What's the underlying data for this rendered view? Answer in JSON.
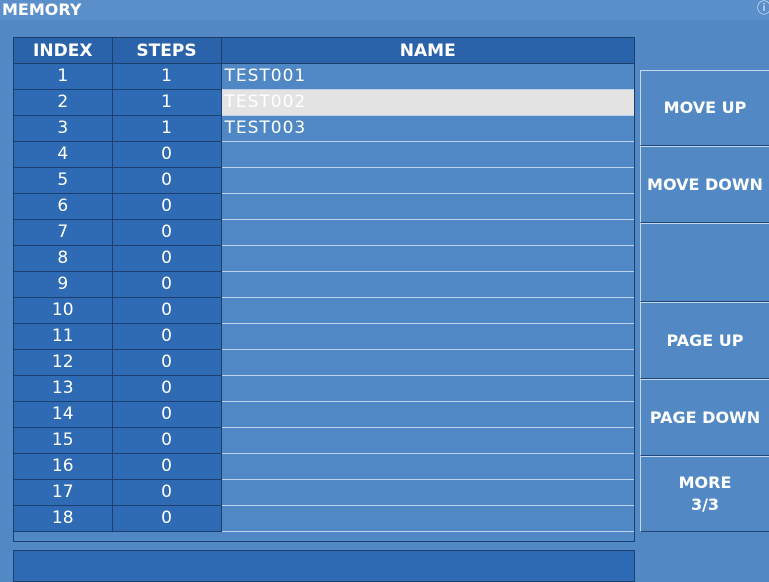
{
  "window": {
    "title": "MEMORY",
    "corner_icon": "info-icon",
    "corner_glyph": "ⓘ"
  },
  "table": {
    "headers": {
      "index": "INDEX",
      "steps": "STEPS",
      "name": "NAME"
    },
    "rows": [
      {
        "index": "1",
        "steps": "1",
        "name": "TEST001",
        "selected": false
      },
      {
        "index": "2",
        "steps": "1",
        "name": "TEST002",
        "selected": true
      },
      {
        "index": "3",
        "steps": "1",
        "name": "TEST003",
        "selected": false
      },
      {
        "index": "4",
        "steps": "0",
        "name": "",
        "selected": false
      },
      {
        "index": "5",
        "steps": "0",
        "name": "",
        "selected": false
      },
      {
        "index": "6",
        "steps": "0",
        "name": "",
        "selected": false
      },
      {
        "index": "7",
        "steps": "0",
        "name": "",
        "selected": false
      },
      {
        "index": "8",
        "steps": "0",
        "name": "",
        "selected": false
      },
      {
        "index": "9",
        "steps": "0",
        "name": "",
        "selected": false
      },
      {
        "index": "10",
        "steps": "0",
        "name": "",
        "selected": false
      },
      {
        "index": "11",
        "steps": "0",
        "name": "",
        "selected": false
      },
      {
        "index": "12",
        "steps": "0",
        "name": "",
        "selected": false
      },
      {
        "index": "13",
        "steps": "0",
        "name": "",
        "selected": false
      },
      {
        "index": "14",
        "steps": "0",
        "name": "",
        "selected": false
      },
      {
        "index": "15",
        "steps": "0",
        "name": "",
        "selected": false
      },
      {
        "index": "16",
        "steps": "0",
        "name": "",
        "selected": false
      },
      {
        "index": "17",
        "steps": "0",
        "name": "",
        "selected": false
      },
      {
        "index": "18",
        "steps": "0",
        "name": "",
        "selected": false
      }
    ]
  },
  "softkeys": {
    "move_up": "MOVE UP",
    "move_down": "MOVE DOWN",
    "blank": "",
    "page_up": "PAGE UP",
    "page_down": "PAGE DOWN",
    "more_line1": "MORE",
    "more_line2": "3/3"
  },
  "status": {
    "text": ""
  },
  "colors": {
    "background": "#5289c4",
    "header": "#2a63a9",
    "index_column": "#2e6bb4",
    "selected_row": "#e3e3e3",
    "text": "#ffffff"
  }
}
